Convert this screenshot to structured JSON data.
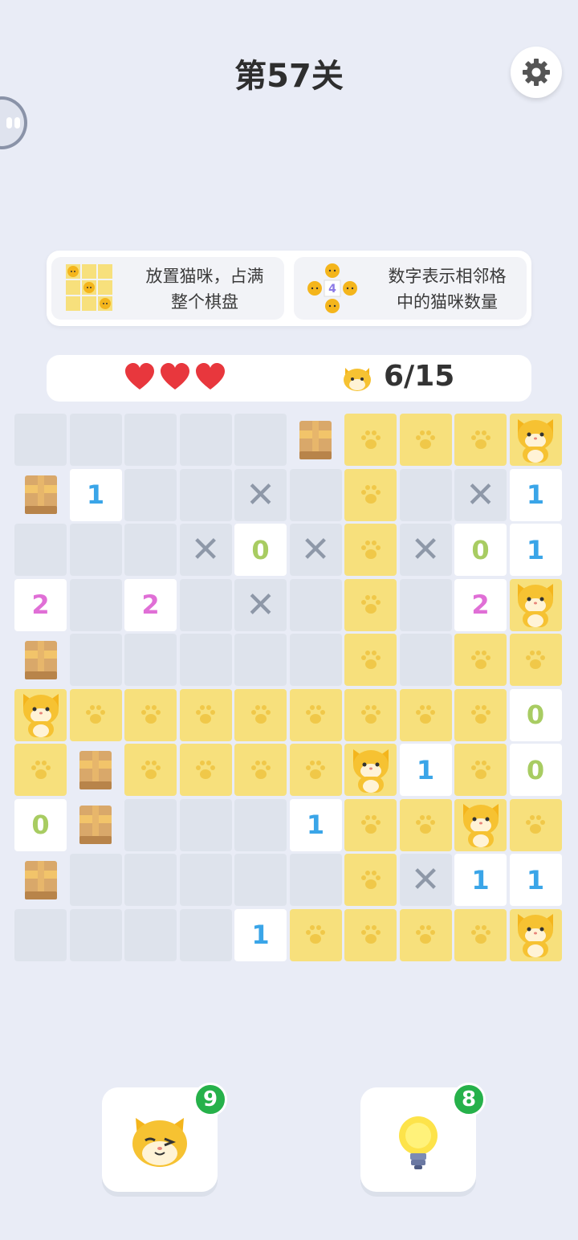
{
  "header": {
    "title": "第57关"
  },
  "rules": {
    "rule1": {
      "line1": "放置猫咪，占满",
      "line2": "整个棋盘"
    },
    "rule2": {
      "line1": "数字表示相邻格",
      "line2": "中的猫咪数量",
      "example_number": "4"
    }
  },
  "status": {
    "lives": 3,
    "cat_counter": "6/15"
  },
  "colors": {
    "empty": "#dee3ec",
    "paw": "#f7e07c",
    "white": "#ffffff",
    "one": "#3aa5e8",
    "zero": "#a8cc62",
    "two": "#e06fd6",
    "x": "#8e98a8"
  },
  "board": {
    "size": 10,
    "legend": {
      "E": "empty cell",
      "P": "paw cell",
      "C": "cat-on-paw cell",
      "B": "box obstacle",
      "X": "crossed cell",
      "0": "clue 0",
      "1": "clue 1",
      "2": "clue 2"
    },
    "rows": [
      [
        "E",
        "E",
        "E",
        "E",
        "E",
        "B",
        "P",
        "P",
        "P",
        "C"
      ],
      [
        "B",
        "1",
        "E",
        "E",
        "X",
        "E",
        "P",
        "E",
        "X",
        "1"
      ],
      [
        "E",
        "E",
        "E",
        "X",
        "0",
        "X",
        "P",
        "X",
        "0",
        "1"
      ],
      [
        "2",
        "E",
        "2",
        "E",
        "X",
        "E",
        "P",
        "E",
        "2",
        "C"
      ],
      [
        "B",
        "E",
        "E",
        "E",
        "E",
        "E",
        "P",
        "E",
        "P",
        "P"
      ],
      [
        "C",
        "P",
        "P",
        "P",
        "P",
        "P",
        "P",
        "P",
        "P",
        "0"
      ],
      [
        "P",
        "B",
        "P",
        "P",
        "P",
        "P",
        "C",
        "1",
        "P",
        "0"
      ],
      [
        "0",
        "B",
        "E",
        "E",
        "E",
        "1",
        "P",
        "P",
        "C",
        "P"
      ],
      [
        "B",
        "E",
        "E",
        "E",
        "E",
        "E",
        "P",
        "X",
        "1",
        "1"
      ],
      [
        "E",
        "E",
        "E",
        "E",
        "1",
        "P",
        "P",
        "P",
        "P",
        "C"
      ]
    ]
  },
  "tools": {
    "cat_tool": {
      "count": "9",
      "icon": "winking-cat-icon"
    },
    "hint_tool": {
      "count": "8",
      "icon": "lightbulb-icon"
    }
  }
}
